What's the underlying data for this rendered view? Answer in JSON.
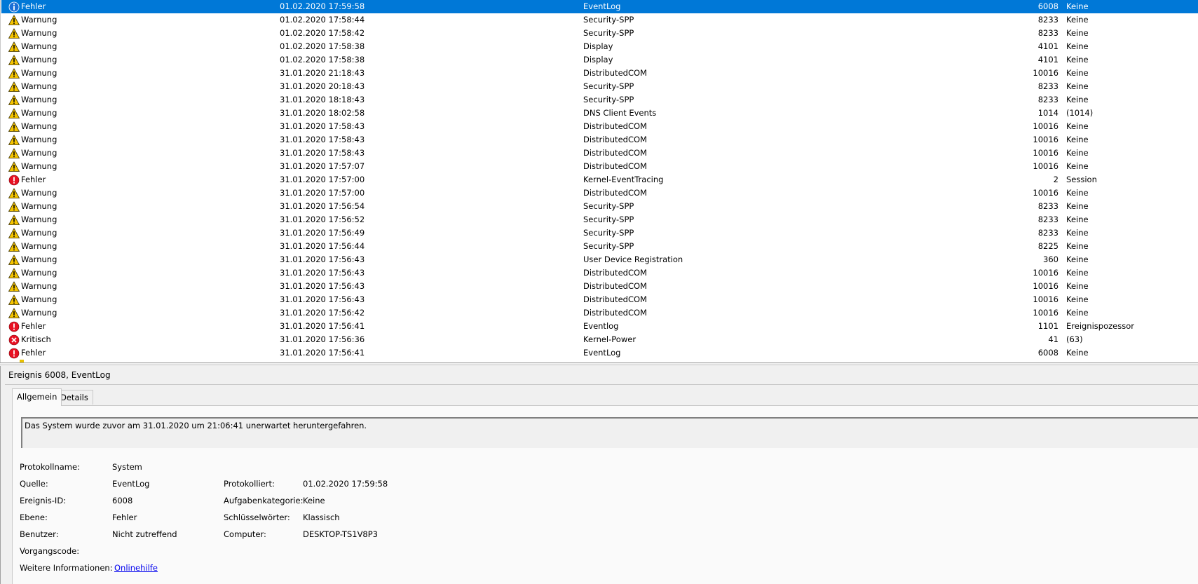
{
  "colors": {
    "selection": "#0078d7",
    "warning": "#f5c400",
    "error": "#e81123",
    "info": "#1a6fd6",
    "link": "#0000ee"
  },
  "events": [
    {
      "icon": "info-icon",
      "level": "Fehler",
      "date": "01.02.2020 17:59:58",
      "source": "EventLog",
      "id": "6008",
      "category": "Keine",
      "selected": true
    },
    {
      "icon": "warning-icon",
      "level": "Warnung",
      "date": "01.02.2020 17:58:44",
      "source": "Security-SPP",
      "id": "8233",
      "category": "Keine"
    },
    {
      "icon": "warning-icon",
      "level": "Warnung",
      "date": "01.02.2020 17:58:42",
      "source": "Security-SPP",
      "id": "8233",
      "category": "Keine"
    },
    {
      "icon": "warning-icon",
      "level": "Warnung",
      "date": "01.02.2020 17:58:38",
      "source": "Display",
      "id": "4101",
      "category": "Keine"
    },
    {
      "icon": "warning-icon",
      "level": "Warnung",
      "date": "01.02.2020 17:58:38",
      "source": "Display",
      "id": "4101",
      "category": "Keine"
    },
    {
      "icon": "warning-icon",
      "level": "Warnung",
      "date": "31.01.2020 21:18:43",
      "source": "DistributedCOM",
      "id": "10016",
      "category": "Keine"
    },
    {
      "icon": "warning-icon",
      "level": "Warnung",
      "date": "31.01.2020 20:18:43",
      "source": "Security-SPP",
      "id": "8233",
      "category": "Keine"
    },
    {
      "icon": "warning-icon",
      "level": "Warnung",
      "date": "31.01.2020 18:18:43",
      "source": "Security-SPP",
      "id": "8233",
      "category": "Keine"
    },
    {
      "icon": "warning-icon",
      "level": "Warnung",
      "date": "31.01.2020 18:02:58",
      "source": "DNS Client Events",
      "id": "1014",
      "category": "(1014)"
    },
    {
      "icon": "warning-icon",
      "level": "Warnung",
      "date": "31.01.2020 17:58:43",
      "source": "DistributedCOM",
      "id": "10016",
      "category": "Keine"
    },
    {
      "icon": "warning-icon",
      "level": "Warnung",
      "date": "31.01.2020 17:58:43",
      "source": "DistributedCOM",
      "id": "10016",
      "category": "Keine"
    },
    {
      "icon": "warning-icon",
      "level": "Warnung",
      "date": "31.01.2020 17:58:43",
      "source": "DistributedCOM",
      "id": "10016",
      "category": "Keine"
    },
    {
      "icon": "warning-icon",
      "level": "Warnung",
      "date": "31.01.2020 17:57:07",
      "source": "DistributedCOM",
      "id": "10016",
      "category": "Keine"
    },
    {
      "icon": "error-icon",
      "level": "Fehler",
      "date": "31.01.2020 17:57:00",
      "source": "Kernel-EventTracing",
      "id": "2",
      "category": "Session"
    },
    {
      "icon": "warning-icon",
      "level": "Warnung",
      "date": "31.01.2020 17:57:00",
      "source": "DistributedCOM",
      "id": "10016",
      "category": "Keine"
    },
    {
      "icon": "warning-icon",
      "level": "Warnung",
      "date": "31.01.2020 17:56:54",
      "source": "Security-SPP",
      "id": "8233",
      "category": "Keine"
    },
    {
      "icon": "warning-icon",
      "level": "Warnung",
      "date": "31.01.2020 17:56:52",
      "source": "Security-SPP",
      "id": "8233",
      "category": "Keine"
    },
    {
      "icon": "warning-icon",
      "level": "Warnung",
      "date": "31.01.2020 17:56:49",
      "source": "Security-SPP",
      "id": "8233",
      "category": "Keine"
    },
    {
      "icon": "warning-icon",
      "level": "Warnung",
      "date": "31.01.2020 17:56:44",
      "source": "Security-SPP",
      "id": "8225",
      "category": "Keine"
    },
    {
      "icon": "warning-icon",
      "level": "Warnung",
      "date": "31.01.2020 17:56:43",
      "source": "User Device Registration",
      "id": "360",
      "category": "Keine"
    },
    {
      "icon": "warning-icon",
      "level": "Warnung",
      "date": "31.01.2020 17:56:43",
      "source": "DistributedCOM",
      "id": "10016",
      "category": "Keine"
    },
    {
      "icon": "warning-icon",
      "level": "Warnung",
      "date": "31.01.2020 17:56:43",
      "source": "DistributedCOM",
      "id": "10016",
      "category": "Keine"
    },
    {
      "icon": "warning-icon",
      "level": "Warnung",
      "date": "31.01.2020 17:56:43",
      "source": "DistributedCOM",
      "id": "10016",
      "category": "Keine"
    },
    {
      "icon": "warning-icon",
      "level": "Warnung",
      "date": "31.01.2020 17:56:42",
      "source": "DistributedCOM",
      "id": "10016",
      "category": "Keine"
    },
    {
      "icon": "error-icon",
      "level": "Fehler",
      "date": "31.01.2020 17:56:41",
      "source": "Eventlog",
      "id": "1101",
      "category": "Ereignispozessor"
    },
    {
      "icon": "critical-icon",
      "level": "Kritisch",
      "date": "31.01.2020 17:56:36",
      "source": "Kernel-Power",
      "id": "41",
      "category": "(63)"
    },
    {
      "icon": "error-icon",
      "level": "Fehler",
      "date": "31.01.2020 17:56:41",
      "source": "EventLog",
      "id": "6008",
      "category": "Keine"
    }
  ],
  "detail": {
    "title": "Ereignis 6008, EventLog",
    "tabs": [
      "Allgemein",
      "Details"
    ],
    "message": "Das System wurde zuvor am 31.01.2020 um 21:06:41 unerwartet heruntergefahren.",
    "fields": {
      "log_name_label": "Protokollname:",
      "log_name": "System",
      "source_label": "Quelle:",
      "source": "EventLog",
      "logged_label": "Protokolliert:",
      "logged": "01.02.2020 17:59:58",
      "event_id_label": "Ereignis-ID:",
      "event_id": "6008",
      "task_category_label": "Aufgabenkategorie:",
      "task_category": "Keine",
      "level_label": "Ebene:",
      "level": "Fehler",
      "keywords_label": "Schlüsselwörter:",
      "keywords": "Klassisch",
      "user_label": "Benutzer:",
      "user": "Nicht zutreffend",
      "computer_label": "Computer:",
      "computer": "DESKTOP-TS1V8P3",
      "opcode_label": "Vorgangscode:",
      "opcode": "",
      "more_info_label": "Weitere Informationen:",
      "more_info_link": "Onlinehilfe"
    }
  }
}
